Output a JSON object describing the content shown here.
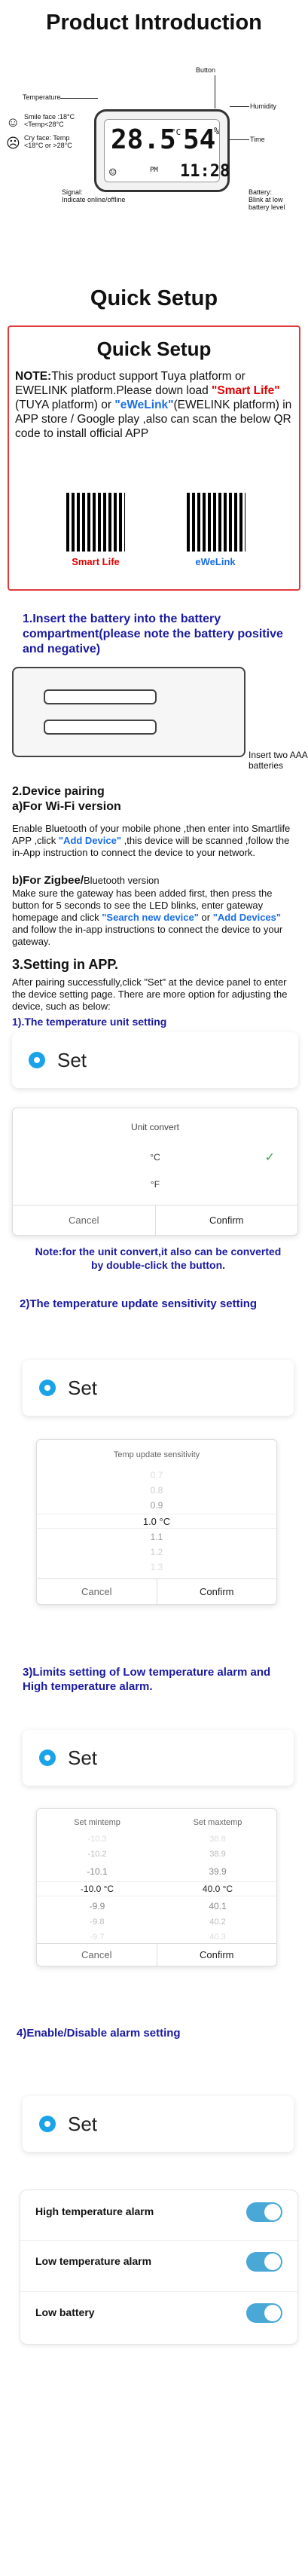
{
  "intro": {
    "title": "Product Introduction",
    "labels": {
      "button": "Button",
      "temperature": "Temperature",
      "humidity": "Humidity",
      "time": "Time",
      "smile": "Smile face :18°C\n<Temp<28°C",
      "cry": "Cry face: Temp\n<18°C or >28°C",
      "signal": "Signal:\nIndicate online/offline",
      "battery": "Battery:\nBlink at low\nbattery level"
    },
    "lcd": {
      "temp": "28.5",
      "unit": "°C",
      "hum": "54",
      "hum_unit": "%",
      "time": "11:28",
      "time_prefix": "PM"
    }
  },
  "quick": {
    "title": "Quick Setup",
    "box_title": "Quick Setup",
    "note_prefix": "NOTE:",
    "note_1": "This product support Tuya platform or EWELINK platform.Please down load ",
    "smart_life_q": "\"Smart Life\"",
    "note_2": "(TUYA platform) or ",
    "ewelink_q": "\"eWeLink\"",
    "note_3": "(EWELINK platform) in APP store / Google play ,also can scan the below QR code to install official APP",
    "app1": "Smart Life",
    "app2": "eWeLink"
  },
  "step1": {
    "title": "1.Insert the battery into the battery compartment(please note the battery positive and negative)",
    "note": "Insert two AAA batteries"
  },
  "step2": {
    "title": "2.Device pairing",
    "sub_a": "a)For Wi-Fi version",
    "text_a_1": "Enable Bluetooth of your mobile phone ,then enter into Smartlife APP ,click ",
    "add_device": "\"Add Device\"",
    "text_a_2": " ,this device will be scanned ,follow the in-App instruction to connect the device to your network.",
    "sub_b": "b)For Zigbee/",
    "sub_b_rest": "Bluetooth version",
    "text_b_1": "Make sure the gateway has been added first, then press the button for 5 seconds to see the LED blinks, enter gateway homepage and click ",
    "search_new": "\"Search new device\"",
    "or": " or ",
    "add_devices": "\"Add Devices\"",
    "text_b_2": " and follow the in-app instructions to connect the device to your gateway."
  },
  "step3": {
    "title": "3.Setting in APP.",
    "text": "After pairing successfully,click \"Set\" at the device panel to enter the device setting page. There are more option for adjusting the device, such as below:",
    "s1_title": "1).The temperature unit setting",
    "set_label": "Set",
    "unit_dialog": {
      "title": "Unit convert",
      "opt1": "°C",
      "opt2": "°F",
      "cancel": "Cancel",
      "confirm": "Confirm"
    },
    "unit_note": "Note:for the unit convert,it also can be converted by double-click the button.",
    "s2_title": "2)The temperature update sensitivity setting",
    "sens_dialog": {
      "title": "Temp update sensitivity",
      "opts": [
        "0.7",
        "0.8",
        "0.9",
        "1.0",
        "1.1",
        "1.2",
        "1.3"
      ],
      "selected_unit": "°C",
      "cancel": "Cancel",
      "confirm": "Confirm"
    },
    "s3_title": "3)Limits setting of Low temperature alarm and High temperature alarm.",
    "limit_dialog": {
      "col1": "Set mintemp",
      "col2": "Set maxtemp",
      "left": [
        "-10.3",
        "-10.2",
        "-10.1",
        "-10.0",
        "-9.9",
        "-9.8",
        "-9.7"
      ],
      "right": [
        "38.8",
        "38.9",
        "39.9",
        "40.0",
        "40.1",
        "40.2",
        "40.3"
      ],
      "unit": "°C",
      "cancel": "Cancel",
      "confirm": "Confirm"
    },
    "s4_title": "4)Enable/Disable alarm setting",
    "alarms": [
      "High temperature alarm",
      "Low temperature alarm",
      "Low battery"
    ]
  },
  "colors": {
    "accent_blue": "#1a6ee6",
    "brand_red": "#e00000",
    "toggle": "#49a8d6",
    "quick_box_border": "#e23b3b"
  }
}
